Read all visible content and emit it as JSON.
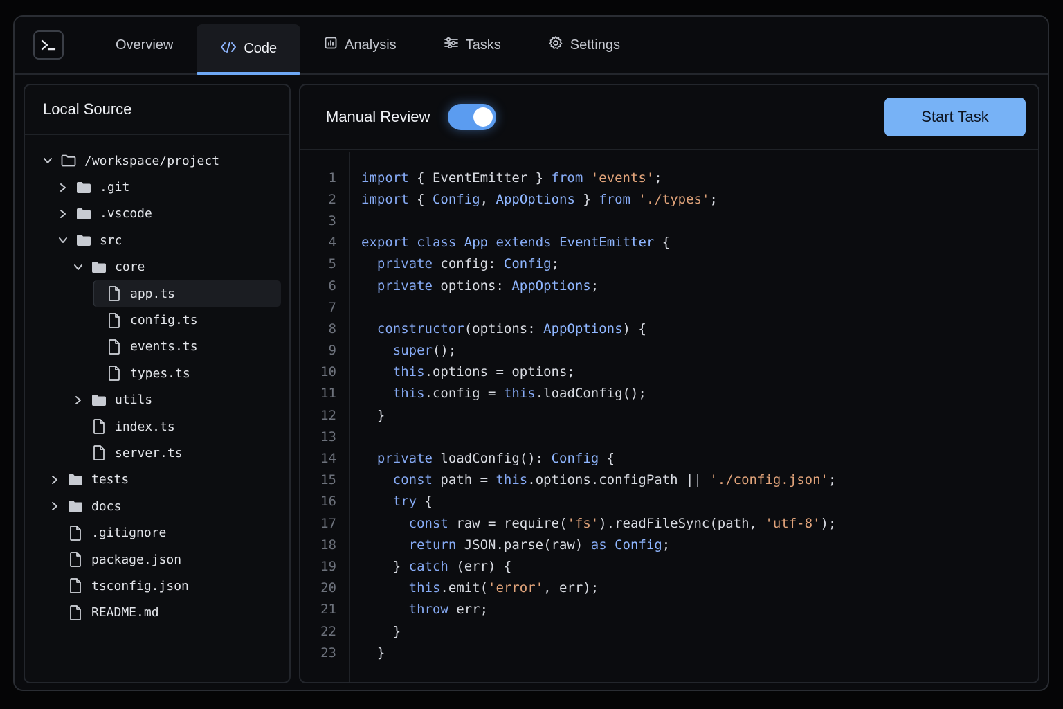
{
  "tabs": [
    {
      "label": "Overview",
      "icon": "",
      "active": false
    },
    {
      "label": "Code",
      "icon": "code-icon",
      "active": true
    },
    {
      "label": "Analysis",
      "icon": "chart-icon",
      "active": false
    },
    {
      "label": "Tasks",
      "icon": "sliders-icon",
      "active": false
    },
    {
      "label": "Settings",
      "icon": "gear-icon",
      "active": false
    }
  ],
  "sidebar": {
    "title": "Local Source",
    "tree": [
      {
        "label": "/workspace/project",
        "depth": 0,
        "type": "folder",
        "expanded": true,
        "outline": true
      },
      {
        "label": ".git",
        "depth": 1,
        "type": "folder",
        "expanded": false
      },
      {
        "label": ".vscode",
        "depth": 1,
        "type": "folder",
        "expanded": false
      },
      {
        "label": "src",
        "depth": 1,
        "type": "folder",
        "expanded": true
      },
      {
        "label": "core",
        "depth": 2,
        "type": "folder",
        "expanded": true
      },
      {
        "label": "app.ts",
        "depth": 3,
        "type": "file",
        "selected": true
      },
      {
        "label": "config.ts",
        "depth": 3,
        "type": "file"
      },
      {
        "label": "events.ts",
        "depth": 3,
        "type": "file"
      },
      {
        "label": "types.ts",
        "depth": 3,
        "type": "file"
      },
      {
        "label": "utils",
        "depth": 2,
        "type": "folder",
        "expanded": false
      },
      {
        "label": "index.ts",
        "depth": 2,
        "type": "file"
      },
      {
        "label": "server.ts",
        "depth": 2,
        "type": "file"
      },
      {
        "label": "tests",
        "depth": 0.5,
        "type": "folder",
        "expanded": false
      },
      {
        "label": "docs",
        "depth": 0.5,
        "type": "folder",
        "expanded": false
      },
      {
        "label": ".gitignore",
        "depth": 0.5,
        "type": "file"
      },
      {
        "label": "package.json",
        "depth": 0.5,
        "type": "file"
      },
      {
        "label": "tsconfig.json",
        "depth": 0.5,
        "type": "file"
      },
      {
        "label": "README.md",
        "depth": 0.5,
        "type": "file"
      }
    ]
  },
  "editor": {
    "review_label": "Manual Review",
    "review_enabled": true,
    "start_label": "Start Task",
    "lines": [
      [
        [
          "k",
          "import"
        ],
        [
          "p",
          " { EventEmitter } "
        ],
        [
          "k",
          "from"
        ],
        [
          "p",
          " "
        ],
        [
          "s",
          "'events'"
        ],
        [
          "p",
          ";"
        ]
      ],
      [
        [
          "k",
          "import"
        ],
        [
          "p",
          " { "
        ],
        [
          "t",
          "Config"
        ],
        [
          "p",
          ", "
        ],
        [
          "t",
          "AppOptions"
        ],
        [
          "p",
          " } "
        ],
        [
          "k",
          "from"
        ],
        [
          "p",
          " "
        ],
        [
          "s",
          "'./types'"
        ],
        [
          "p",
          ";"
        ]
      ],
      [],
      [
        [
          "k",
          "export"
        ],
        [
          "p",
          " "
        ],
        [
          "k",
          "class"
        ],
        [
          "p",
          " "
        ],
        [
          "t",
          "App"
        ],
        [
          "p",
          " "
        ],
        [
          "k",
          "extends"
        ],
        [
          "p",
          " "
        ],
        [
          "t",
          "EventEmitter"
        ],
        [
          "p",
          " {"
        ]
      ],
      [
        [
          "p",
          "  "
        ],
        [
          "k",
          "private"
        ],
        [
          "p",
          " config: "
        ],
        [
          "t",
          "Config"
        ],
        [
          "p",
          ";"
        ]
      ],
      [
        [
          "p",
          "  "
        ],
        [
          "k",
          "private"
        ],
        [
          "p",
          " options: "
        ],
        [
          "t",
          "AppOptions"
        ],
        [
          "p",
          ";"
        ]
      ],
      [],
      [
        [
          "p",
          "  "
        ],
        [
          "k",
          "constructor"
        ],
        [
          "p",
          "(options: "
        ],
        [
          "t",
          "AppOptions"
        ],
        [
          "p",
          ") {"
        ]
      ],
      [
        [
          "p",
          "    "
        ],
        [
          "k",
          "super"
        ],
        [
          "p",
          "();"
        ]
      ],
      [
        [
          "p",
          "    "
        ],
        [
          "k",
          "this"
        ],
        [
          "p",
          ".options = options;"
        ]
      ],
      [
        [
          "p",
          "    "
        ],
        [
          "k",
          "this"
        ],
        [
          "p",
          ".config = "
        ],
        [
          "k",
          "this"
        ],
        [
          "p",
          ".loadConfig();"
        ]
      ],
      [
        [
          "p",
          "  }"
        ]
      ],
      [],
      [
        [
          "p",
          "  "
        ],
        [
          "k",
          "private"
        ],
        [
          "p",
          " loadConfig(): "
        ],
        [
          "t",
          "Config"
        ],
        [
          "p",
          " {"
        ]
      ],
      [
        [
          "p",
          "    "
        ],
        [
          "k",
          "const"
        ],
        [
          "p",
          " path = "
        ],
        [
          "k",
          "this"
        ],
        [
          "p",
          ".options.configPath || "
        ],
        [
          "s",
          "'./config.json'"
        ],
        [
          "p",
          ";"
        ]
      ],
      [
        [
          "p",
          "    "
        ],
        [
          "k",
          "try"
        ],
        [
          "p",
          " {"
        ]
      ],
      [
        [
          "p",
          "      "
        ],
        [
          "k",
          "const"
        ],
        [
          "p",
          " raw = require("
        ],
        [
          "s",
          "'fs'"
        ],
        [
          "p",
          ").readFileSync(path, "
        ],
        [
          "s",
          "'utf-8'"
        ],
        [
          "p",
          ");"
        ]
      ],
      [
        [
          "p",
          "      "
        ],
        [
          "k",
          "return"
        ],
        [
          "p",
          " JSON.parse(raw) "
        ],
        [
          "k",
          "as"
        ],
        [
          "p",
          " "
        ],
        [
          "t",
          "Config"
        ],
        [
          "p",
          ";"
        ]
      ],
      [
        [
          "p",
          "    } "
        ],
        [
          "k",
          "catch"
        ],
        [
          "p",
          " (err) {"
        ]
      ],
      [
        [
          "p",
          "      "
        ],
        [
          "k",
          "this"
        ],
        [
          "p",
          ".emit("
        ],
        [
          "s",
          "'error'"
        ],
        [
          "p",
          ", err);"
        ]
      ],
      [
        [
          "p",
          "      "
        ],
        [
          "k",
          "throw"
        ],
        [
          "p",
          " err;"
        ]
      ],
      [
        [
          "p",
          "    }"
        ]
      ],
      [
        [
          "p",
          "  }"
        ]
      ]
    ]
  },
  "colors": {
    "accent": "#6ea8f5",
    "button": "#77b2f6",
    "keyword": "#86aaf4",
    "string": "#e0a37a"
  }
}
